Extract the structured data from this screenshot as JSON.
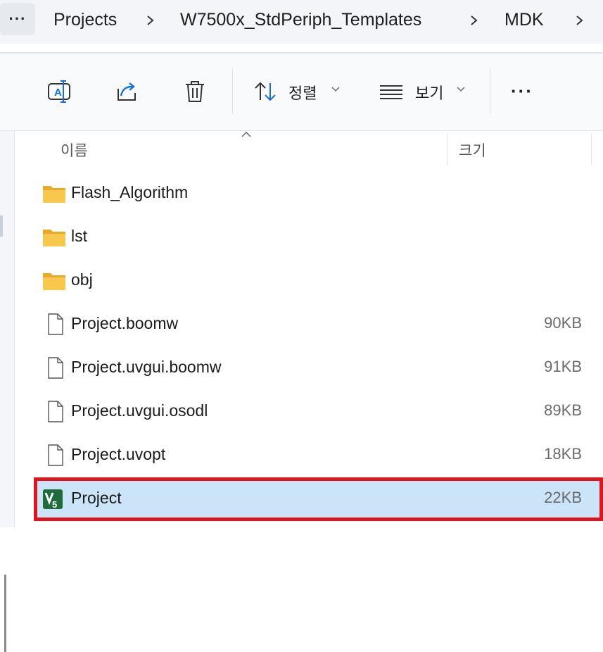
{
  "breadcrumb": {
    "more_label": "···",
    "items": [
      "Projects",
      "W7500x_StdPeriph_Templates",
      "MDK"
    ]
  },
  "toolbar": {
    "sort_label": "정렬",
    "view_label": "보기",
    "more_label": "···"
  },
  "columns": {
    "name": "이름",
    "size": "크기"
  },
  "files": [
    {
      "name": "Flash_Algorithm",
      "size": "",
      "type": "folder"
    },
    {
      "name": "lst",
      "size": "",
      "type": "folder"
    },
    {
      "name": "obj",
      "size": "",
      "type": "folder"
    },
    {
      "name": "Project.boomw",
      "size": "90KB",
      "type": "file"
    },
    {
      "name": "Project.uvgui.boomw",
      "size": "91KB",
      "type": "file"
    },
    {
      "name": "Project.uvgui.osodl",
      "size": "89KB",
      "type": "file"
    },
    {
      "name": "Project.uvopt",
      "size": "18KB",
      "type": "file"
    },
    {
      "name": "Project",
      "size": "22KB",
      "type": "uvproj",
      "selected": true
    }
  ],
  "colors": {
    "selection": "#cce4f7",
    "highlight_border": "#e0141e",
    "folder": "#f5c242"
  }
}
